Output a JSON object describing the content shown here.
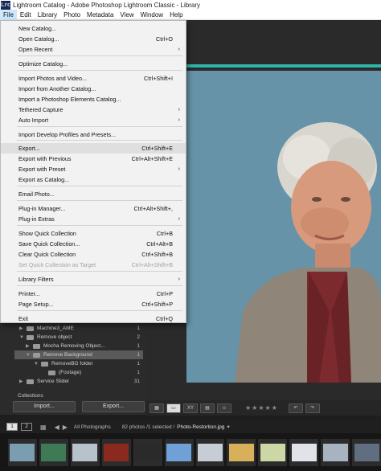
{
  "window": {
    "title": "Lightroom Catalog - Adobe Photoshop Lightroom Classic - Library",
    "app_icon": "Lrc"
  },
  "menubar": [
    "File",
    "Edit",
    "Library",
    "Photo",
    "Metadata",
    "View",
    "Window",
    "Help"
  ],
  "file_menu": {
    "items": [
      {
        "label": "New Catalog...",
        "shortcut": "",
        "submenu": false,
        "disabled": false
      },
      {
        "label": "Open Catalog...",
        "shortcut": "Ctrl+O",
        "submenu": false,
        "disabled": false
      },
      {
        "label": "Open Recent",
        "shortcut": "",
        "submenu": true,
        "disabled": false
      },
      {
        "label": "Optimize Catalog...",
        "shortcut": "",
        "submenu": false,
        "disabled": false
      },
      {
        "label": "Import Photos and Video...",
        "shortcut": "Ctrl+Shift+I",
        "submenu": false,
        "disabled": false
      },
      {
        "label": "Import from Another Catalog...",
        "shortcut": "",
        "submenu": false,
        "disabled": false
      },
      {
        "label": "Import a Photoshop Elements Catalog...",
        "shortcut": "",
        "submenu": false,
        "disabled": false
      },
      {
        "label": "Tethered Capture",
        "shortcut": "",
        "submenu": true,
        "disabled": false
      },
      {
        "label": "Auto Import",
        "shortcut": "",
        "submenu": true,
        "disabled": false
      },
      {
        "label": "Import Develop Profiles and Presets...",
        "shortcut": "",
        "submenu": false,
        "disabled": false
      },
      {
        "label": "Export...",
        "shortcut": "Ctrl+Shift+E",
        "submenu": false,
        "disabled": false,
        "highlighted": true
      },
      {
        "label": "Export with Previous",
        "shortcut": "Ctrl+Alt+Shift+E",
        "submenu": false,
        "disabled": false
      },
      {
        "label": "Export with Preset",
        "shortcut": "",
        "submenu": true,
        "disabled": false
      },
      {
        "label": "Export as Catalog...",
        "shortcut": "",
        "submenu": false,
        "disabled": false
      },
      {
        "label": "Email Photo...",
        "shortcut": "",
        "submenu": false,
        "disabled": false
      },
      {
        "label": "Plug-in Manager...",
        "shortcut": "Ctrl+Alt+Shift+,",
        "submenu": false,
        "disabled": false
      },
      {
        "label": "Plug-in Extras",
        "shortcut": "",
        "submenu": true,
        "disabled": false
      },
      {
        "label": "Show Quick Collection",
        "shortcut": "Ctrl+B",
        "submenu": false,
        "disabled": false
      },
      {
        "label": "Save Quick Collection...",
        "shortcut": "Ctrl+Alt+B",
        "submenu": false,
        "disabled": false
      },
      {
        "label": "Clear Quick Collection",
        "shortcut": "Ctrl+Shift+B",
        "submenu": false,
        "disabled": false
      },
      {
        "label": "Set Quick Collection as Target",
        "shortcut": "Ctrl+Alt+Shift+B",
        "submenu": false,
        "disabled": true
      },
      {
        "label": "Library Filters",
        "shortcut": "",
        "submenu": true,
        "disabled": false
      },
      {
        "label": "Printer...",
        "shortcut": "Ctrl+P",
        "submenu": false,
        "disabled": false
      },
      {
        "label": "Page Setup...",
        "shortcut": "Ctrl+Shift+P",
        "submenu": false,
        "disabled": false
      },
      {
        "label": "Exit",
        "shortcut": "Ctrl+Q",
        "submenu": false,
        "disabled": false
      }
    ]
  },
  "folders": [
    {
      "label": "Machine3_AME",
      "count": "1",
      "level": 1,
      "expanded": false
    },
    {
      "label": "Remove object",
      "count": "2",
      "level": 1,
      "expanded": true
    },
    {
      "label": "Mocha Removing Object...",
      "count": "1",
      "level": 2,
      "expanded": false
    },
    {
      "label": "Remove Background",
      "count": "1",
      "level": 2,
      "expanded": true,
      "selected": true
    },
    {
      "label": "RemoveBG folder",
      "count": "1",
      "level": 3,
      "expanded": true
    },
    {
      "label": "(Footage)",
      "count": "1",
      "level": 4,
      "expanded": false
    },
    {
      "label": "Service Slider",
      "count": "31",
      "level": 1,
      "expanded": false
    }
  ],
  "collections_label": "Collections",
  "panel_buttons": {
    "import": "Import...",
    "export": "Export..."
  },
  "toolbar": {
    "stars": "★★★★★"
  },
  "filmstrip_bar": {
    "page1": "1",
    "page2": "2",
    "source": "All Photographs",
    "count": "82 photos /1 selected /",
    "filename": "Photo-Restortion.jpg",
    "dropdown": "▾"
  },
  "thumbnails": [
    {
      "name": "thumb-1",
      "color": "#7a9eb0"
    },
    {
      "name": "thumb-2",
      "color": "#3e7a55"
    },
    {
      "name": "thumb-3",
      "color": "#b8c2ca"
    },
    {
      "name": "thumb-4",
      "color": "#8a2a1e"
    },
    {
      "name": "thumb-5",
      "color": "#2a2a2a"
    },
    {
      "name": "thumb-6",
      "color": "#6fa1d6"
    },
    {
      "name": "thumb-7",
      "color": "#c6cdd4"
    },
    {
      "name": "thumb-8",
      "color": "#d9b05a"
    },
    {
      "name": "thumb-9",
      "color": "#cbd7a4"
    },
    {
      "name": "thumb-10",
      "color": "#e0e3e8"
    },
    {
      "name": "thumb-11",
      "color": "#a8b3c2"
    },
    {
      "name": "thumb-12",
      "color": "#5f6e80"
    }
  ]
}
